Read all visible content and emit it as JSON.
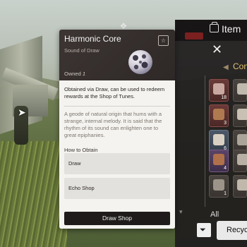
{
  "item_card": {
    "title": "Harmonic Core",
    "subtitle": "Sound of Draw",
    "owned_label": "Owned",
    "owned_count": "1",
    "description": "Obtained via Draw, can be used to redeem rewards at the Shop of Tunes.",
    "lore": "A geode of natural origin that hums with a strange, internal melody. It is said that the rhythm of its sound can enlighten one to great epiphanies.",
    "how_to_obtain_label": "How to Obtain",
    "obtain_sources": [
      "Draw",
      "Echo Shop"
    ],
    "cta_label": "Draw Shop"
  },
  "inventory": {
    "title": "Item",
    "category_label": "Con",
    "filter_label": "All",
    "recycle_label": "Recycle",
    "slot_counts": [
      "18",
      "3",
      "6",
      "4",
      "1"
    ]
  }
}
